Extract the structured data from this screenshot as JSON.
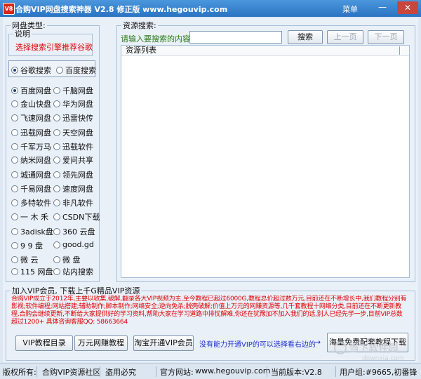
{
  "window": {
    "title": "合购VIP网盘搜索神器 V2.8 修正版 www.hegouvip.com",
    "icon_label": "V8",
    "menu": "菜单",
    "minimize": "—",
    "close": "✕"
  },
  "left": {
    "legend": "网盘类型:",
    "note_legend": "说明",
    "note_text": "选择搜索引擎推荐谷歌",
    "engines": [
      {
        "label": "谷歌搜索",
        "checked": true
      },
      {
        "label": "百度搜索",
        "checked": false
      }
    ],
    "disks": [
      {
        "label": "百度网盘",
        "checked": true
      },
      {
        "label": "千脑网盘",
        "checked": false
      },
      {
        "label": "金山快盘",
        "checked": false
      },
      {
        "label": "华为网盘",
        "checked": false
      },
      {
        "label": "飞速网盘",
        "checked": false
      },
      {
        "label": "迅雷快传",
        "checked": false
      },
      {
        "label": "迅载网盘",
        "checked": false
      },
      {
        "label": "天空网盘",
        "checked": false
      },
      {
        "label": "千军万马",
        "checked": false
      },
      {
        "label": "迅载软件",
        "checked": false
      },
      {
        "label": "纳米网盘",
        "checked": false
      },
      {
        "label": "爱问共享",
        "checked": false
      },
      {
        "label": "城通网盘",
        "checked": false
      },
      {
        "label": "领先网盘",
        "checked": false
      },
      {
        "label": "千易网盘",
        "checked": false
      },
      {
        "label": "速度网盘",
        "checked": false
      },
      {
        "label": "多特软件",
        "checked": false
      },
      {
        "label": "非凡软件",
        "checked": false
      },
      {
        "label": "一 木 禾",
        "checked": false
      },
      {
        "label": "CSDN下载",
        "checked": false
      },
      {
        "label": "3adisk盘",
        "checked": false
      },
      {
        "label": "360 云盘",
        "checked": false
      },
      {
        "label": "9 9 盘",
        "checked": false
      },
      {
        "label": "good.gd",
        "checked": false
      },
      {
        "label": "微 云",
        "checked": false
      },
      {
        "label": "微 盘",
        "checked": false
      },
      {
        "label": "115 网盘",
        "checked": false
      },
      {
        "label": "站内搜索",
        "checked": false
      }
    ]
  },
  "search": {
    "legend": "资源搜索:",
    "prompt": "请输入要搜索的内容:",
    "input_value": "",
    "search_btn": "搜索",
    "prev_btn": "上一页",
    "next_btn": "下一页",
    "list_header": "资源列表"
  },
  "vip": {
    "legend": "加入VIP会员, 下载上千G精品VIP资源",
    "desc": "合购VIP成立于2012年,主要以收集,破解,翻录各大VIP视频为主,至今教程已超过6000G,教程总价超过数万元,目前还在不断增长中,我们教程分别有影视;软件编程;网站搭建;辅助制作;脚本制作;网络安全;逆向免杀;脱壳破解;价值上万元的网赚资源等,几千套教程十网络分类,目前还在不断更新教程,合购会继续更新,不断给大家提供好的学习资料,帮助大家在学习道路中排忧解难,你还在犹豫加不加入我们的话,别人已经先学一步,目前VIP总数超过1200+ 具体咨询客服QQ: 58663664",
    "btn_course": "VIP教程目录",
    "btn_earn": "万元网赚教程",
    "btn_taobao": "淘宝开通VIP会员",
    "hint": "没有能力开通VIP的可以选择看右边的",
    "arrow": "→",
    "btn_free": "海量免费配套教程下载"
  },
  "status": {
    "copyright": "版权所有:",
    "owner": "合购VIP资源社区",
    "piracy": "盗用必究",
    "site_label": "官方网站:",
    "site": "www.hegouvip.com",
    "version": "当前版本:V2.8",
    "users": "用户组:#9665,初番锋"
  },
  "watermark": {
    "main": "当下软件园",
    "sub": "downxia.com"
  },
  "colors": {
    "red_text": "#e00000",
    "blue_text": "#2030d0",
    "titlebar": "#2e7ac8"
  }
}
